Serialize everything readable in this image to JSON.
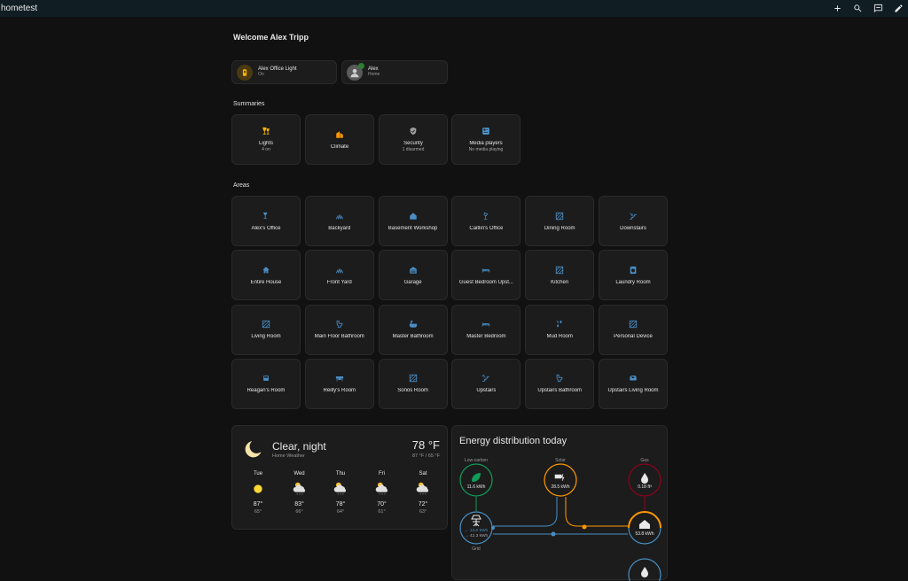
{
  "app": {
    "title": "hometest"
  },
  "welcome": "Welcome Alex Tripp",
  "chips": [
    {
      "name": "Alex Office Light",
      "state": "On"
    },
    {
      "name": "Alex",
      "state": "Home"
    }
  ],
  "summaries": {
    "title": "Summaries",
    "items": [
      {
        "label": "Lights",
        "sub": "4 on",
        "icon": "lamp-icon",
        "color": "#ffb300"
      },
      {
        "label": "Climate",
        "sub": "",
        "icon": "thermostat-icon",
        "color": "#ff9800"
      },
      {
        "label": "Security",
        "sub": "1 disarmed",
        "icon": "shield-icon",
        "color": "#9e9e9e"
      },
      {
        "label": "Media players",
        "sub": "No media playing",
        "icon": "media-icon",
        "color": "#4fa3e0"
      }
    ]
  },
  "areas": {
    "title": "Areas",
    "items": [
      {
        "label": "Alex's Office",
        "icon": "desk-lamp-icon"
      },
      {
        "label": "Backyard",
        "icon": "grass-icon"
      },
      {
        "label": "Basement Workshop",
        "icon": "home-floor-icon"
      },
      {
        "label": "Caitlin's Office",
        "icon": "lamp-icon"
      },
      {
        "label": "Dining Room",
        "icon": "texture-box-icon"
      },
      {
        "label": "Downstairs",
        "icon": "stairs-down-icon"
      },
      {
        "label": "Entire House",
        "icon": "home-icon"
      },
      {
        "label": "Front Yard",
        "icon": "grass-icon"
      },
      {
        "label": "Garage",
        "icon": "garage-icon"
      },
      {
        "label": "Guest Bedroom Upst...",
        "icon": "bed-icon"
      },
      {
        "label": "Kitchen",
        "icon": "texture-box-icon"
      },
      {
        "label": "Laundry Room",
        "icon": "washing-machine-icon"
      },
      {
        "label": "Living Room",
        "icon": "texture-box-icon"
      },
      {
        "label": "Main Floor Bathroom",
        "icon": "toilet-icon"
      },
      {
        "label": "Master Bathroom",
        "icon": "bathtub-icon"
      },
      {
        "label": "Master Bedroom",
        "icon": "bed-icon"
      },
      {
        "label": "Mud Room",
        "icon": "shoe-icon"
      },
      {
        "label": "Personal Device",
        "icon": "texture-box-icon"
      },
      {
        "label": "Reagan's Room",
        "icon": "bed-single-icon"
      },
      {
        "label": "Reilly's Room",
        "icon": "desk-icon"
      },
      {
        "label": "Sonos Room",
        "icon": "texture-box-icon"
      },
      {
        "label": "Upstairs",
        "icon": "stairs-up-icon"
      },
      {
        "label": "Upstairs Bathroom",
        "icon": "toilet-icon"
      },
      {
        "label": "Upstairs Living Room",
        "icon": "sofa-icon"
      }
    ]
  },
  "weather": {
    "condition": "Clear, night",
    "source": "Home Weather",
    "temp": "78 °F",
    "hilo": "87 °F / 65 °F",
    "forecast": [
      {
        "day": "Tue",
        "icon": "sun-icon",
        "high": "87°",
        "low": "65°"
      },
      {
        "day": "Wed",
        "icon": "cloud-rain-icon",
        "high": "83°",
        "low": "66°"
      },
      {
        "day": "Thu",
        "icon": "cloud-rain-icon",
        "high": "78°",
        "low": "64°"
      },
      {
        "day": "Fri",
        "icon": "cloud-rain-icon",
        "high": "70°",
        "low": "61°"
      },
      {
        "day": "Sat",
        "icon": "cloud-rain-icon",
        "high": "72°",
        "low": "63°"
      }
    ]
  },
  "energy": {
    "title": "Energy distribution today",
    "low_carbon": {
      "label": "Low-carbon",
      "value": "11.6 kWh",
      "color": "#0f9d58"
    },
    "solar": {
      "label": "Solar",
      "value": "28.5 kWh",
      "color": "#ff9800"
    },
    "gas": {
      "label": "Gas",
      "value": "0.18 ft³",
      "color": "#8e021b"
    },
    "grid": {
      "label": "Grid",
      "in": "← 13.0 kWh",
      "out": "→ 42.3 kWh",
      "color": "#488fc2"
    },
    "home": {
      "value": "53.8 kWh"
    }
  }
}
